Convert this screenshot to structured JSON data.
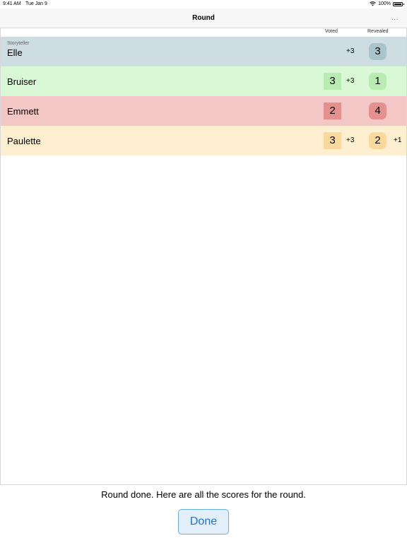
{
  "status": {
    "time": "9:41 AM",
    "date": "Tue Jan 9",
    "battery": "100%"
  },
  "nav": {
    "title": "Round",
    "more": "..."
  },
  "columns": {
    "voted": "Voted",
    "revealed": "Revealed"
  },
  "rows": [
    {
      "role": "Storyteller",
      "name": "Elle",
      "voted": "",
      "voted_points": "+3",
      "revealed": "3",
      "revealed_points": "",
      "row_color": "#cddde2",
      "box_color": "#aac4cc"
    },
    {
      "role": "",
      "name": "Bruiser",
      "voted": "3",
      "voted_points": "+3",
      "revealed": "1",
      "revealed_points": "",
      "row_color": "#d9f8d5",
      "box_color": "#b9ecb3"
    },
    {
      "role": "",
      "name": "Emmett",
      "voted": "2",
      "voted_points": "",
      "revealed": "4",
      "revealed_points": "",
      "row_color": "#f3c7c5",
      "box_color": "#e3908e"
    },
    {
      "role": "",
      "name": "Paulette",
      "voted": "3",
      "voted_points": "+3",
      "revealed": "2",
      "revealed_points": "+1",
      "row_color": "#fdefd0",
      "box_color": "#fad99c"
    }
  ],
  "footer": {
    "message": "Round done. Here are all the scores for the round.",
    "done_label": "Done"
  }
}
